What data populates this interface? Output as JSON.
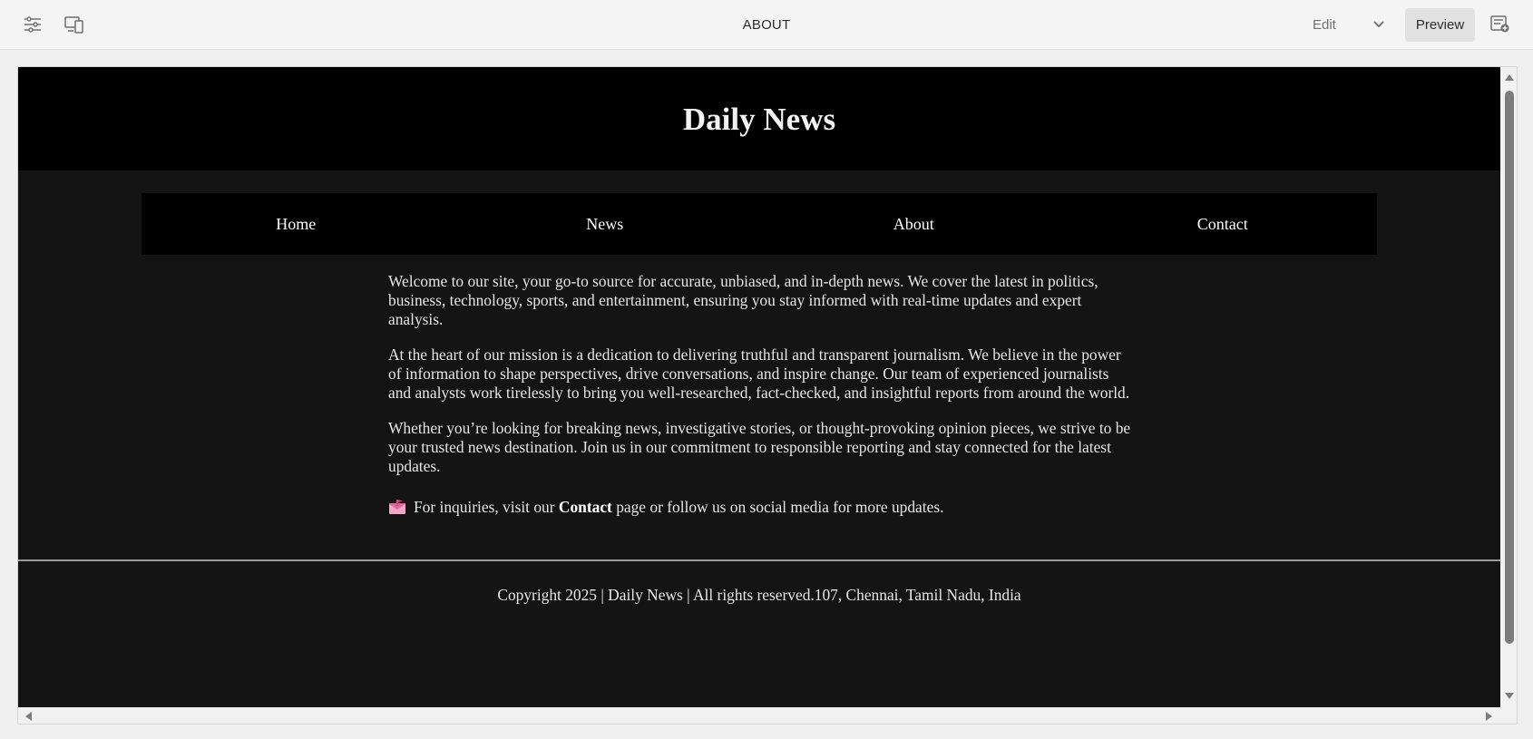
{
  "toolbar": {
    "page_title": "ABOUT",
    "edit_label": "Edit",
    "preview_label": "Preview",
    "icons": [
      "sliders-icon",
      "device-preview-icon",
      "chevron-down-icon",
      "page-info-icon"
    ]
  },
  "site": {
    "title": "Daily News",
    "nav": [
      "Home",
      "News",
      "About",
      "Contact"
    ],
    "paragraphs": [
      "Welcome to our site, your go-to source for accurate, unbiased, and in-depth news. We cover the latest in politics, business, technology, sports, and entertainment, ensuring you stay informed with real-time updates and expert analysis.",
      "At the heart of our mission is a dedication to delivering truthful and transparent journalism. We believe in the power of information to shape perspectives, drive conversations, and inspire change. Our team of experienced journalists and analysts work tirelessly to bring you well-researched, fact-checked, and insightful reports from around the world.",
      "Whether you’re looking for breaking news, investigative stories, or thought-provoking opinion pieces, we strive to be your trusted news destination. Join us in our commitment to responsible reporting and stay connected for the latest updates."
    ],
    "inquiry": {
      "before": "For inquiries, visit our ",
      "link": "Contact",
      "after": " page or follow us on social media for more updates."
    },
    "footer": "Copyright 2025 | Daily News | All rights reserved.107, Chennai, Tamil Nadu, India"
  },
  "colors": {
    "page_bg": "#141414",
    "header_bg": "#000000",
    "text": "#e6e6e6",
    "toolbar_bg": "#f4f4f4"
  }
}
